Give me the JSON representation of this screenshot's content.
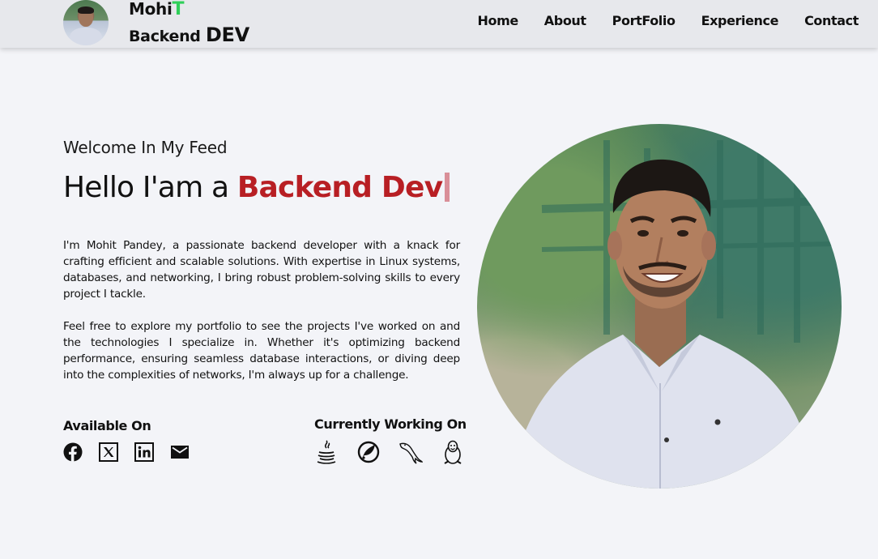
{
  "header": {
    "brand_name_main": "Mohi",
    "brand_name_accent": "T",
    "brand_role_main": "Backend ",
    "brand_role_big": "DEV",
    "nav": [
      "Home",
      "About",
      "PortFolio",
      "Experience",
      "Contact"
    ]
  },
  "hero": {
    "welcome": "Welcome In My Feed",
    "hello_prefix": "Hello I'am a ",
    "hello_role": "Backend Dev",
    "para1": "I'm Mohit Pandey, a passionate backend developer with a knack for crafting efficient and scalable solutions. With expertise in Linux systems, databases, and networking, I bring robust problem-solving skills to every project I tackle.",
    "para2": "Feel free to explore my portfolio to see the projects I've worked on and the technologies I specialize in. Whether it's optimizing backend performance, ensuring seamless database interactions, or diving deep into the complexities of networks, I'm always up for a challenge.",
    "available_title": "Available On",
    "working_title": "Currently Working On",
    "social_icons": [
      "facebook-icon",
      "x-twitter-icon",
      "linkedin-icon",
      "email-icon"
    ],
    "tech_icons": [
      "java-icon",
      "spring-icon",
      "mysql-icon",
      "linux-tux-icon"
    ]
  },
  "colors": {
    "accent_green": "#2fcf59",
    "accent_red": "#b81f24",
    "caret": "#d98f98",
    "background": "#f3f4f8",
    "header_bg": "#e7e8ec"
  }
}
